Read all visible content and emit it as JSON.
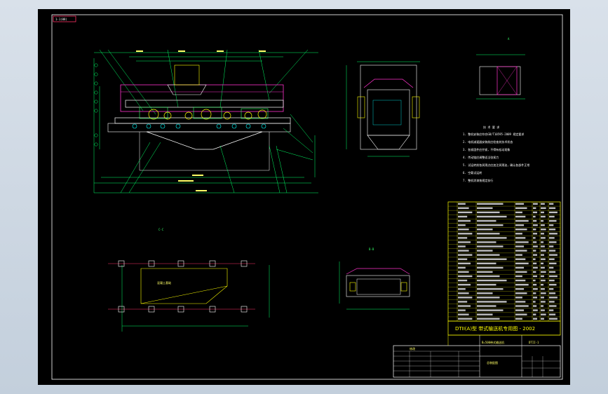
{
  "drawing": {
    "frame_tag": "1-1(08)",
    "views": {
      "section_label": "C-C",
      "view_a": "A",
      "view_b": "B-B"
    },
    "notes_header": "技 术 要 求",
    "notes": [
      "1. 整机安装应符合GB/T10595-2009 规定要求",
      "2. 电机减速器安装前应检查其技术状态",
      "3. 各紧固件应拧紧，不得有松动现象",
      "4. 传动链应调整适当张紧力",
      "5. 试运转前各润滑点应加注润滑油，确认各部件正常",
      "6. 空载试运转",
      "7. 整机涂漆按规定执行"
    ],
    "hatch_label": "混凝土基础",
    "title_block": {
      "company": "DTII(A)型 带式输送机专用图 - 2002",
      "drawing_name": "B=500带式输送机",
      "code": "DTII-1",
      "sheet_label": "总装配图"
    },
    "revision_header": "修改"
  }
}
